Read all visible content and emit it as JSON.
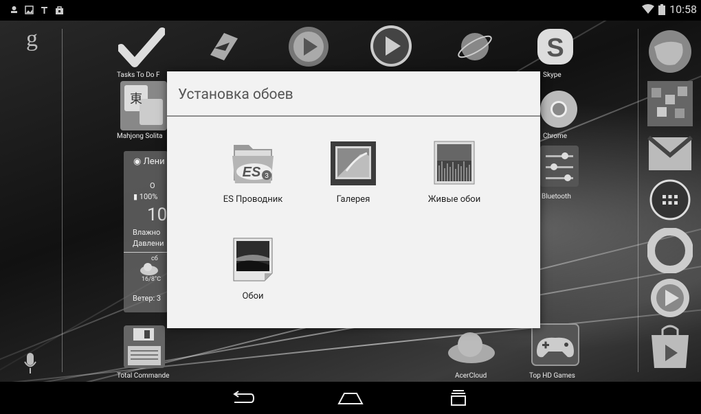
{
  "status_bar": {
    "time": "10:58",
    "left_icons": [
      "usb-debug-icon",
      "image-notification-icon",
      "t-notification-icon",
      "shopping-bag-icon"
    ],
    "right_icons": [
      "wifi-icon",
      "battery-icon"
    ]
  },
  "launcher": {
    "google_letter": "g",
    "apps": [
      {
        "label": "Tasks To Do F",
        "icon": "checkmark-icon"
      },
      {
        "label": "Mahjong Solita",
        "icon": "mahjong-icon"
      },
      {
        "label": "Skype",
        "icon": "skype-icon"
      },
      {
        "label": "Chrome",
        "icon": "chrome-icon"
      },
      {
        "label": "Bluetooth",
        "icon": "bluetooth-settings-icon"
      },
      {
        "label": "Total Commande",
        "icon": "floppy-icon"
      },
      {
        "label": "AcerCloud",
        "icon": "cloud-icon"
      },
      {
        "label": "Top HD Games",
        "icon": "gamepad-icon"
      }
    ],
    "weather_widget": {
      "city": "Лени",
      "line_o": "О",
      "battery": "100%",
      "temp": "10",
      "humidity": "Влажно",
      "pressure": "Давлени",
      "day": "сб",
      "forecast_temp": "16/8°С",
      "wind": "Ветер: 3"
    }
  },
  "dialog": {
    "title": "Установка обоев",
    "options": [
      {
        "label": "ES Проводник",
        "icon": "es-explorer-icon"
      },
      {
        "label": "Галерея",
        "icon": "gallery-icon"
      },
      {
        "label": "Живые обои",
        "icon": "live-wallpaper-icon"
      },
      {
        "label": "Обои",
        "icon": "wallpapers-icon"
      }
    ]
  },
  "nav_bar": {
    "buttons": [
      "back-icon",
      "home-icon",
      "recent-apps-icon"
    ]
  }
}
